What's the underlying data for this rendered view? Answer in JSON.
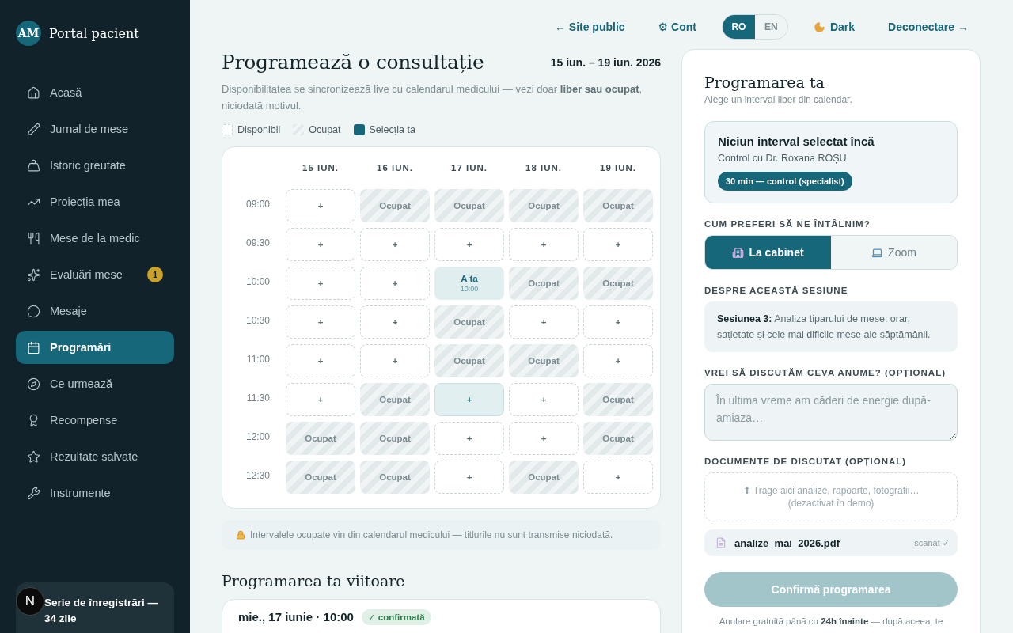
{
  "sidebar": {
    "avatar": "AM",
    "brand": "Portal pacient",
    "items": [
      {
        "label": "Acasă",
        "selected": false
      },
      {
        "label": "Jurnal de mese",
        "selected": false
      },
      {
        "label": "Istoric greutate",
        "selected": false
      },
      {
        "label": "Proiecția mea",
        "selected": false
      },
      {
        "label": "Mese de la medic",
        "selected": false
      },
      {
        "label": "Evaluări mese",
        "selected": false,
        "badge": "1"
      },
      {
        "label": "Mesaje",
        "selected": false
      },
      {
        "label": "Programări",
        "selected": true
      },
      {
        "label": "Ce urmează",
        "selected": false
      },
      {
        "label": "Recompense",
        "selected": false
      },
      {
        "label": "Rezultate salvate",
        "selected": false
      },
      {
        "label": "Instrumente",
        "selected": false
      }
    ],
    "streak": {
      "title": "Serie de înregistrări — 34 zile"
    },
    "dev_badge": "N"
  },
  "topbar": {
    "links": [
      {
        "label": "← Site public"
      },
      {
        "label": "⚙ Cont"
      }
    ],
    "languages": [
      {
        "label": "RO",
        "selected": true
      },
      {
        "label": "EN",
        "selected": false
      }
    ],
    "theme": "Dark",
    "logout": "Deconectare →"
  },
  "booking": {
    "title": "Programează o consultație",
    "range": "15 iun. – 19 iun. 2026",
    "description": "Disponibilitatea se sincronizează live cu calendarul medicului — vezi doar **liber sau ocupat**, niciodată motivul.",
    "legend": [
      {
        "kind": "free",
        "label": "Disponibil"
      },
      {
        "kind": "busy",
        "label": "Ocupat"
      },
      {
        "kind": "mine",
        "label": "Selecția ta"
      }
    ],
    "days": [
      "15 IUN.",
      "16 IUN.",
      "17 IUN.",
      "18 IUN.",
      "19 IUN."
    ],
    "rows": [
      {
        "time": "09:00",
        "cells": [
          {
            "kind": "free",
            "text": "+"
          },
          {
            "kind": "busy",
            "text": "Ocupat"
          },
          {
            "kind": "busy",
            "text": "Ocupat"
          },
          {
            "kind": "busy",
            "text": "Ocupat"
          },
          {
            "kind": "busy",
            "text": "Ocupat"
          }
        ]
      },
      {
        "time": "09:30",
        "cells": [
          {
            "kind": "free",
            "text": "+"
          },
          {
            "kind": "free",
            "text": "+"
          },
          {
            "kind": "free",
            "text": "+"
          },
          {
            "kind": "free",
            "text": "+"
          },
          {
            "kind": "free",
            "text": "+"
          }
        ]
      },
      {
        "time": "10:00",
        "cells": [
          {
            "kind": "free",
            "text": "+"
          },
          {
            "kind": "free",
            "text": "+"
          },
          {
            "kind": "mine",
            "text": "A ta",
            "sub": "10:00"
          },
          {
            "kind": "busy",
            "text": "Ocupat"
          },
          {
            "kind": "busy",
            "text": "Ocupat"
          }
        ]
      },
      {
        "time": "10:30",
        "cells": [
          {
            "kind": "free",
            "text": "+"
          },
          {
            "kind": "free",
            "text": "+"
          },
          {
            "kind": "busy",
            "text": "Ocupat"
          },
          {
            "kind": "free",
            "text": "+"
          },
          {
            "kind": "free",
            "text": "+"
          }
        ]
      },
      {
        "time": "11:00",
        "cells": [
          {
            "kind": "free",
            "text": "+"
          },
          {
            "kind": "free",
            "text": "+"
          },
          {
            "kind": "busy",
            "text": "Ocupat"
          },
          {
            "kind": "busy",
            "text": "Ocupat"
          },
          {
            "kind": "free",
            "text": "+"
          }
        ]
      },
      {
        "time": "11:30",
        "cells": [
          {
            "kind": "free",
            "text": "+"
          },
          {
            "kind": "busy",
            "text": "Ocupat"
          },
          {
            "kind": "hover",
            "text": "+"
          },
          {
            "kind": "free",
            "text": "+"
          },
          {
            "kind": "busy",
            "text": "Ocupat"
          }
        ]
      },
      {
        "time": "12:00",
        "cells": [
          {
            "kind": "busy",
            "text": "Ocupat"
          },
          {
            "kind": "busy",
            "text": "Ocupat"
          },
          {
            "kind": "free",
            "text": "+"
          },
          {
            "kind": "free",
            "text": "+"
          },
          {
            "kind": "busy",
            "text": "Ocupat"
          }
        ]
      },
      {
        "time": "12:30",
        "cells": [
          {
            "kind": "busy",
            "text": "Ocupat"
          },
          {
            "kind": "busy",
            "text": "Ocupat"
          },
          {
            "kind": "free",
            "text": "+"
          },
          {
            "kind": "busy",
            "text": "Ocupat"
          },
          {
            "kind": "free",
            "text": "+"
          }
        ]
      }
    ],
    "privacy_note": "Intervalele ocupate vin din calendarul medicului — titlurile nu sunt transmise niciodată."
  },
  "upcoming": {
    "title": "Programarea ta viitoare",
    "date": "mie., 17 iunie · 10:00",
    "status": "✓ confirmată"
  },
  "panel": {
    "title": "Programarea ta",
    "subtitle": "Alege un interval liber din calendar.",
    "summary": {
      "title": "Niciun interval selectat încă",
      "doctor": "Control cu Dr. Roxana ROȘU",
      "pill": "30 min — control (specialist)"
    },
    "mode_label": "CUM PREFERI SĂ NE ÎNTÂLNIM?",
    "modes": [
      {
        "label": "La cabinet",
        "selected": true
      },
      {
        "label": "Zoom",
        "selected": false
      }
    ],
    "session_label": "DESPRE ACEASTĂ SESIUNE",
    "session_text": "**Sesiunea 3:** Analiza tiparului de mese: orar, sațietate și cele mai dificile mese ale săptămânii.",
    "topic_label": "VREI SĂ DISCUTĂM CEVA ANUME? (OPȚIONAL)",
    "topic_placeholder": "În ultima vreme am căderi de energie după-amiaza…",
    "docs_label": "DOCUMENTE DE DISCUTAT (OPȚIONAL)",
    "dropzone": [
      "⬆ Trage aici analize, rapoarte, fotografii…",
      "(dezactivat în demo)"
    ],
    "files": [
      {
        "name": "analize_mai_2026.pdf",
        "status": "scanat ✓"
      }
    ],
    "confirm": {
      "label": "Confirmă programarea",
      "disabled": true
    },
    "cancel_note": "Anulare gratuită până cu **24h înainte** — după aceea, te"
  }
}
